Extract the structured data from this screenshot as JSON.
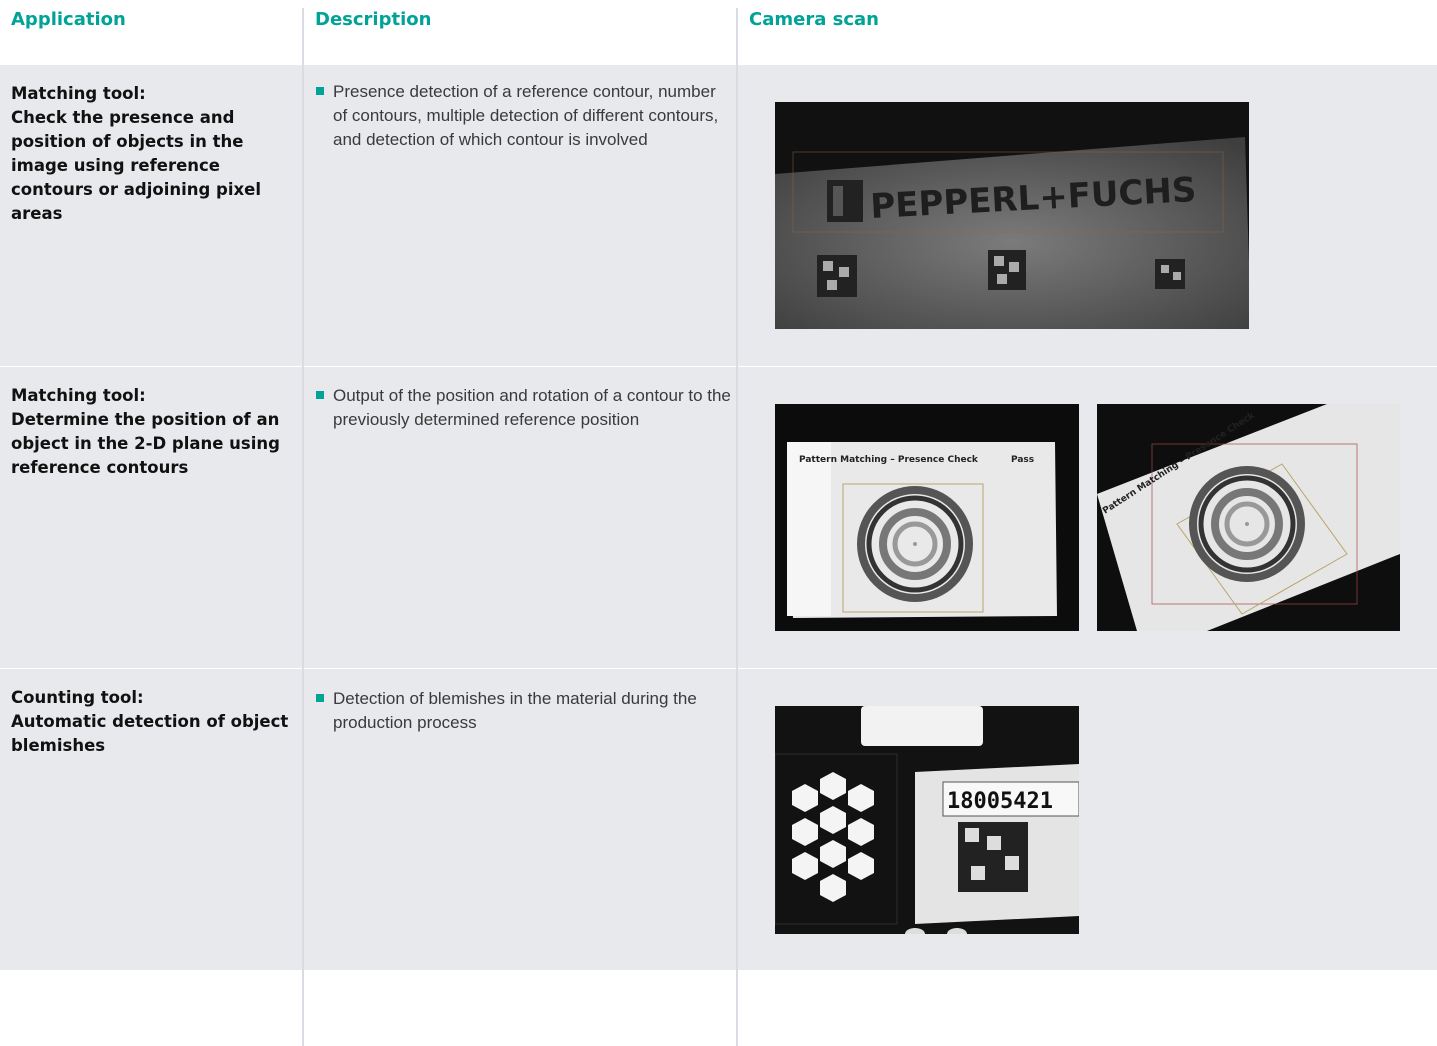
{
  "headers": {
    "application": "Application",
    "description": "Description",
    "camera_scan": "Camera scan"
  },
  "rows": [
    {
      "app_line1": "Matching tool:",
      "app_rest": "Check the presence and position of objects in the image using reference contours or adjoining pixel areas",
      "description": "Presence detection of a reference contour, number of contours, multiple detection of different contours, and detection of which contour is involved",
      "scan_text": "PEPPERL+FUCHS"
    },
    {
      "app_line1": "Matching tool:",
      "app_rest": "Determine the position of an object in the 2-D plane using reference contours",
      "description": "Output of the position and rotation of a contour to the previously determined reference position",
      "scan_caption": "Pattern Matching – Presence Check",
      "scan_status": "Pass"
    },
    {
      "app_line1": "Counting tool:",
      "app_rest": "Automatic detection of object blemishes",
      "description": "Detection of blemishes in the material during the production process",
      "scan_number": "18005421"
    }
  ]
}
